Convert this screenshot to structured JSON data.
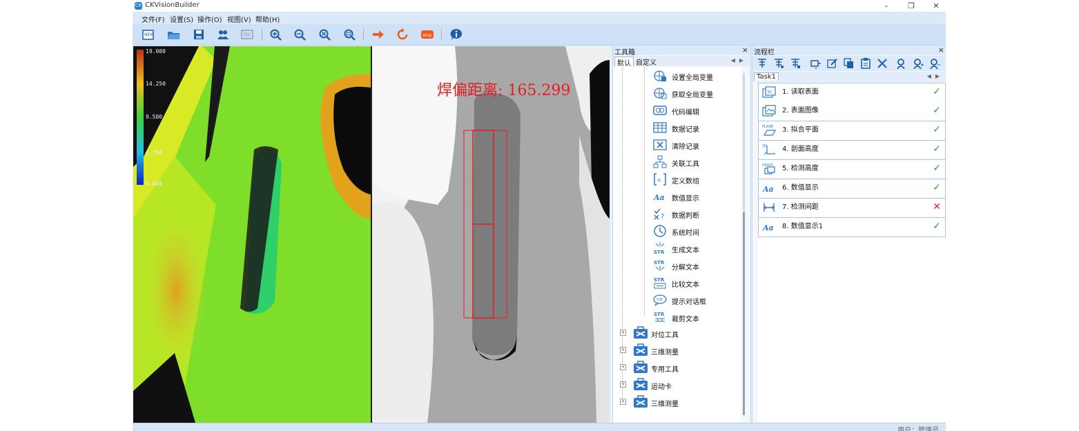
{
  "window": {
    "title": "CKVisionBuilder",
    "controls": [
      "–",
      "❐",
      "✕"
    ]
  },
  "menu": [
    {
      "label": "文件(F)"
    },
    {
      "label": "设置(S)"
    },
    {
      "label": "操作(O)"
    },
    {
      "label": "视图(V)"
    },
    {
      "label": "帮助(H)"
    }
  ],
  "toolbar": [
    {
      "icon": "new-file-icon"
    },
    {
      "icon": "open-folder-icon"
    },
    {
      "icon": "save-icon"
    },
    {
      "icon": "users-icon"
    },
    {
      "icon": "image-frame-icon"
    },
    {
      "icon": "zoom-in-icon"
    },
    {
      "icon": "zoom-out-icon"
    },
    {
      "icon": "zoom-fit-icon"
    },
    {
      "icon": "zoom-actual-icon"
    },
    {
      "icon": "run-once-icon"
    },
    {
      "icon": "run-loop-icon"
    },
    {
      "icon": "stop-icon",
      "label": "stop"
    },
    {
      "icon": "info-icon"
    }
  ],
  "viewer": {
    "colorbar": {
      "labels": [
        "19.000",
        "14.250",
        "9.500",
        "4.750",
        "0.000"
      ]
    },
    "measurement": "焊偏距离: 165.299",
    "measurement_color": "#e02020"
  },
  "toolbox": {
    "title": "工具箱",
    "close": "×",
    "tabs": [
      "默认",
      "自定义"
    ],
    "tools": [
      {
        "label": "设置全局变量",
        "icon": "set-global-variable-icon"
      },
      {
        "label": "获取全局变量",
        "icon": "get-global-variable-icon"
      },
      {
        "label": "代码编辑",
        "icon": "code-edit-icon"
      },
      {
        "label": "数据记录",
        "icon": "data-record-icon"
      },
      {
        "label": "清除记录",
        "icon": "clear-record-icon"
      },
      {
        "label": "关联工具",
        "icon": "link-tool-icon"
      },
      {
        "label": "定义数组",
        "icon": "define-array-icon"
      },
      {
        "label": "数值显示",
        "icon": "value-display-icon"
      },
      {
        "label": "数据判断",
        "icon": "data-judge-icon"
      },
      {
        "label": "系统时间",
        "icon": "system-time-icon"
      },
      {
        "label": "生成文本",
        "icon": "generate-text-icon"
      },
      {
        "label": "分解文本",
        "icon": "split-text-icon"
      },
      {
        "label": "比较文本",
        "icon": "compare-text-icon"
      },
      {
        "label": "提示对话框",
        "icon": "prompt-dialog-icon"
      },
      {
        "label": "裁剪文本",
        "icon": "trim-text-icon"
      }
    ],
    "groups": [
      {
        "label": "对位工具"
      },
      {
        "label": "三维测量"
      },
      {
        "label": "专用工具"
      },
      {
        "label": "运动卡"
      },
      {
        "label": "三维测量"
      }
    ]
  },
  "flow": {
    "title": "流程栏",
    "close": "×",
    "task_tab": "Task1",
    "toolbar_icons": [
      "add-step-icon",
      "insert-step-icon",
      "append-step-icon",
      "run-step-icon",
      "edit-step-icon",
      "copy-step-icon",
      "paste-step-icon",
      "delete-step-icon",
      "user-icon",
      "user-add-icon",
      "user-remove-icon"
    ],
    "steps": [
      {
        "label": "1. 读取表面",
        "status": "ok",
        "icon": "read-surface-icon"
      },
      {
        "label": "2. 表面图像",
        "status": "ok",
        "icon": "surface-image-icon"
      },
      {
        "label": "3. 拟合平面",
        "status": "ok",
        "icon": "plane-fit-icon"
      },
      {
        "label": "4. 剖面高度",
        "status": "ok",
        "icon": "profile-height-icon"
      },
      {
        "label": "5. 检测高度",
        "status": "ok",
        "icon": "detect-height-icon"
      },
      {
        "label": "6. 数值显示",
        "status": "ok",
        "icon": "value-display-icon"
      },
      {
        "label": "7. 检测间距",
        "status": "fail",
        "icon": "detect-distance-icon"
      },
      {
        "label": "8. 数值显示1",
        "status": "ok",
        "icon": "value-display-icon"
      }
    ],
    "ok_symbol": "✓",
    "fail_symbol": "✕",
    "ok_color": "#2aa832",
    "fail_color": "#e0202a"
  },
  "status": {
    "user": "用户：管理员"
  }
}
